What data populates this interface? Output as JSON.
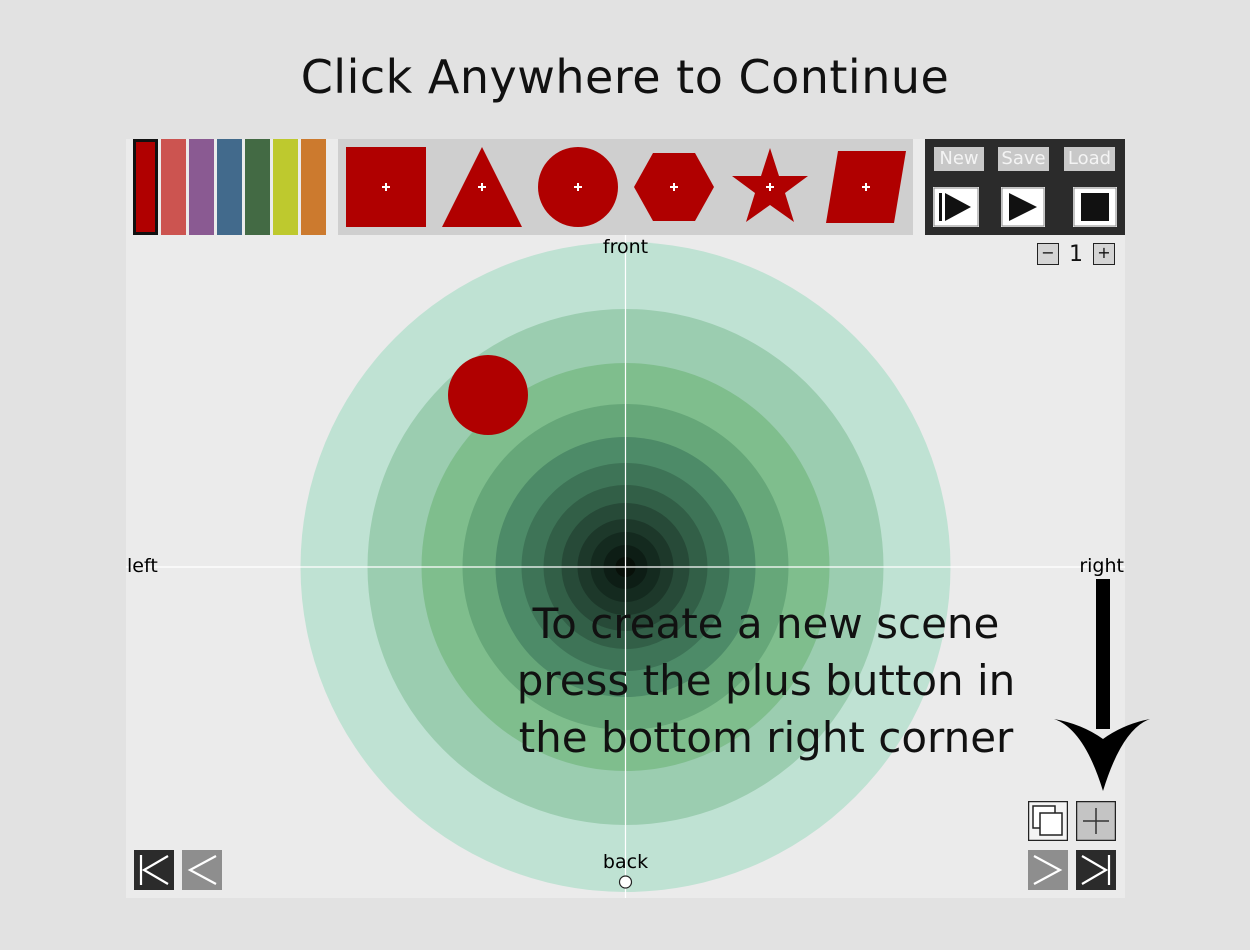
{
  "overlay": {
    "title": "Click Anywhere to Continue",
    "tutorial_text": "To create a new scene press the plus button in the bottom right corner"
  },
  "palette": {
    "colors": [
      "#b00000",
      "#cc5450",
      "#8a5a92",
      "#426a8c",
      "#436a44",
      "#bec92e",
      "#cc7a2e"
    ],
    "selected_index": 0
  },
  "shapes": {
    "fill": "#b00000",
    "items": [
      "square-icon",
      "triangle-icon",
      "circle-icon",
      "hexagon-icon",
      "star-icon",
      "parallelogram-icon"
    ]
  },
  "controls": {
    "new_label": "New",
    "save_label": "Save",
    "load_label": "Load",
    "play_buttons": [
      "play-from-start-icon",
      "play-icon",
      "stop-icon"
    ]
  },
  "scene_counter": {
    "minus_label": "−",
    "value": "1",
    "plus_label": "+"
  },
  "stage": {
    "labels": {
      "front": "front",
      "back": "back",
      "left": "left",
      "right": "right"
    },
    "placed_object": {
      "shape": "circle",
      "color": "#b00000"
    },
    "ring_colors": [
      "#bfe2d3",
      "#9bcdb0",
      "#7fbe8d",
      "#66a779",
      "#4d8b68",
      "#3e7457",
      "#325f47",
      "#274a38",
      "#1d382a",
      "#142a1f",
      "#0d1d15",
      "#081009"
    ]
  },
  "bottom_bar": {
    "icons": [
      "first-scene-icon",
      "previous-scene-icon",
      "next-scene-icon",
      "last-scene-icon",
      "duplicate-scene-icon",
      "add-scene-icon"
    ]
  }
}
